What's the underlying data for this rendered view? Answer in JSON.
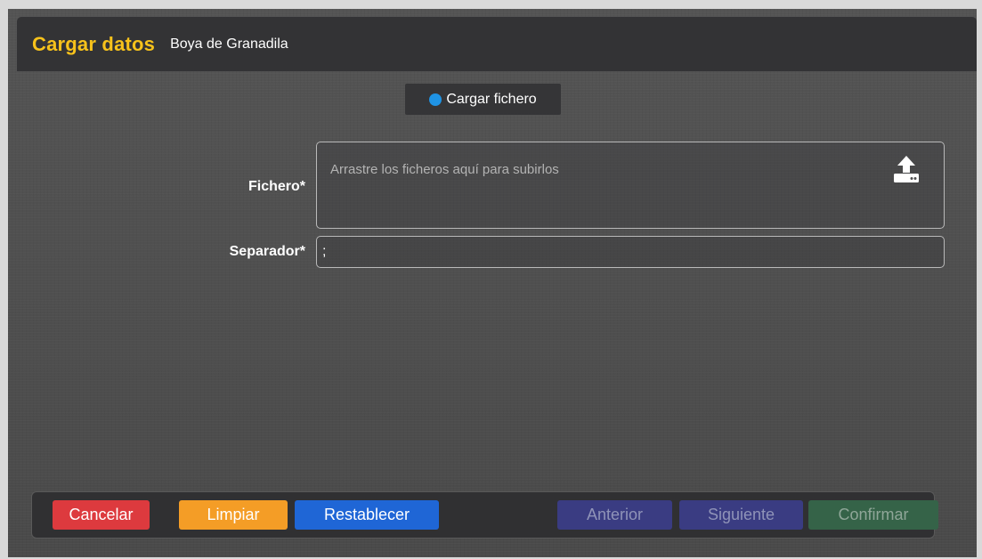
{
  "header": {
    "title": "Cargar datos",
    "subtitle": "Boya de Granadila"
  },
  "tab": {
    "label": "Cargar fichero",
    "dot_color": "#1f93e4"
  },
  "form": {
    "file_label": "Fichero*",
    "file_placeholder": "Arrastre los ficheros aquí para subirlos",
    "upload_icon": "upload-icon",
    "separator_label": "Separador*",
    "separator_value": ";"
  },
  "footer": {
    "cancel_label": "Cancelar",
    "clear_label": "Limpiar",
    "reset_label": "Restablecer",
    "previous_label": "Anterior",
    "next_label": "Siguiente",
    "confirm_label": "Confirmar"
  },
  "colors": {
    "title_accent": "#f7c21b",
    "cancel": "#dd3a3e",
    "clear": "#f49d26",
    "reset": "#1f66d6",
    "nav_disabled": "#3a3c82",
    "confirm_disabled": "#356348"
  }
}
